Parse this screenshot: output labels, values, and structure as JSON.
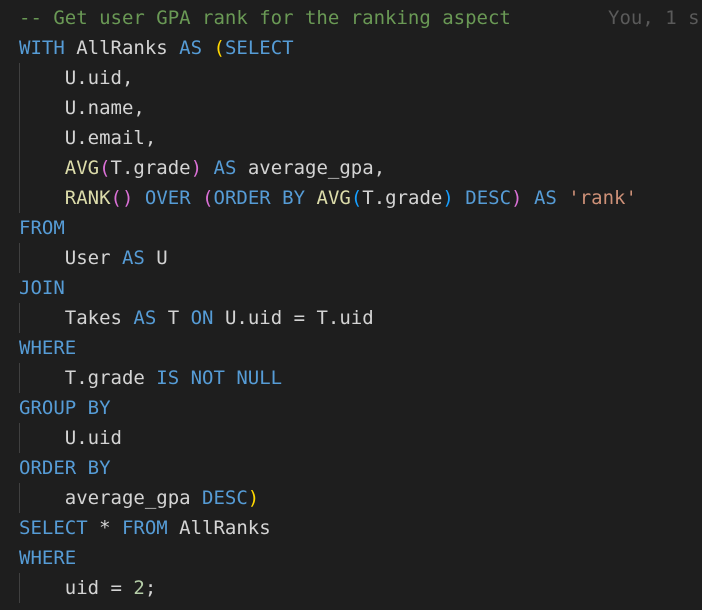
{
  "editor": {
    "language": "sql",
    "blame_text": "You, 1 s",
    "lines": [
      {
        "tokens": [
          {
            "t": "-- Get user GPA rank for the ranking aspect",
            "c": "comment"
          }
        ]
      },
      {
        "tokens": [
          {
            "t": "WITH",
            "c": "keyword"
          },
          {
            "t": " AllRanks ",
            "c": "ident"
          },
          {
            "t": "AS",
            "c": "keyword"
          },
          {
            "t": " ",
            "c": "ident"
          },
          {
            "t": "(",
            "c": "brace"
          },
          {
            "t": "SELECT",
            "c": "keyword"
          }
        ]
      },
      {
        "tokens": [
          {
            "t": "    U.uid,",
            "c": "ident"
          }
        ]
      },
      {
        "tokens": [
          {
            "t": "    U.name,",
            "c": "ident"
          }
        ]
      },
      {
        "tokens": [
          {
            "t": "    U.email,",
            "c": "ident"
          }
        ]
      },
      {
        "tokens": [
          {
            "t": "    ",
            "c": "ident"
          },
          {
            "t": "AVG",
            "c": "function"
          },
          {
            "t": "(",
            "c": "brace2"
          },
          {
            "t": "T.grade",
            "c": "ident"
          },
          {
            "t": ")",
            "c": "brace2"
          },
          {
            "t": " ",
            "c": "ident"
          },
          {
            "t": "AS",
            "c": "keyword"
          },
          {
            "t": " average_gpa,",
            "c": "ident"
          }
        ]
      },
      {
        "tokens": [
          {
            "t": "    ",
            "c": "ident"
          },
          {
            "t": "RANK",
            "c": "function"
          },
          {
            "t": "()",
            "c": "brace2"
          },
          {
            "t": " ",
            "c": "ident"
          },
          {
            "t": "OVER",
            "c": "keyword"
          },
          {
            "t": " ",
            "c": "ident"
          },
          {
            "t": "(",
            "c": "brace2"
          },
          {
            "t": "ORDER BY",
            "c": "keyword"
          },
          {
            "t": " ",
            "c": "ident"
          },
          {
            "t": "AVG",
            "c": "function"
          },
          {
            "t": "(",
            "c": "brace3"
          },
          {
            "t": "T.grade",
            "c": "ident"
          },
          {
            "t": ")",
            "c": "brace3"
          },
          {
            "t": " ",
            "c": "ident"
          },
          {
            "t": "DESC",
            "c": "keyword"
          },
          {
            "t": ")",
            "c": "brace2"
          },
          {
            "t": " ",
            "c": "ident"
          },
          {
            "t": "AS",
            "c": "keyword"
          },
          {
            "t": " ",
            "c": "ident"
          },
          {
            "t": "'rank'",
            "c": "string"
          }
        ]
      },
      {
        "tokens": [
          {
            "t": "FROM",
            "c": "keyword"
          }
        ]
      },
      {
        "tokens": [
          {
            "t": "    User ",
            "c": "ident"
          },
          {
            "t": "AS",
            "c": "keyword"
          },
          {
            "t": " U",
            "c": "ident"
          }
        ]
      },
      {
        "tokens": [
          {
            "t": "JOIN",
            "c": "keyword"
          }
        ]
      },
      {
        "tokens": [
          {
            "t": "    Takes ",
            "c": "ident"
          },
          {
            "t": "AS",
            "c": "keyword"
          },
          {
            "t": " T ",
            "c": "ident"
          },
          {
            "t": "ON",
            "c": "keyword"
          },
          {
            "t": " U.uid = T.uid",
            "c": "ident"
          }
        ]
      },
      {
        "tokens": [
          {
            "t": "WHERE",
            "c": "keyword"
          }
        ]
      },
      {
        "tokens": [
          {
            "t": "    T.grade ",
            "c": "ident"
          },
          {
            "t": "IS NOT NULL",
            "c": "keyword"
          }
        ]
      },
      {
        "tokens": [
          {
            "t": "GROUP BY",
            "c": "keyword"
          }
        ]
      },
      {
        "tokens": [
          {
            "t": "    U.uid",
            "c": "ident"
          }
        ]
      },
      {
        "tokens": [
          {
            "t": "ORDER BY",
            "c": "keyword"
          }
        ]
      },
      {
        "tokens": [
          {
            "t": "    average_gpa ",
            "c": "ident"
          },
          {
            "t": "DESC",
            "c": "keyword"
          },
          {
            "t": ")",
            "c": "brace"
          }
        ]
      },
      {
        "tokens": [
          {
            "t": "SELECT",
            "c": "keyword"
          },
          {
            "t": " * ",
            "c": "ident"
          },
          {
            "t": "FROM",
            "c": "keyword"
          },
          {
            "t": " AllRanks",
            "c": "ident"
          }
        ]
      },
      {
        "tokens": [
          {
            "t": "WHERE",
            "c": "keyword"
          }
        ]
      },
      {
        "tokens": [
          {
            "t": "    uid = ",
            "c": "ident"
          },
          {
            "t": "2",
            "c": "number"
          },
          {
            "t": ";",
            "c": "ident"
          }
        ]
      }
    ]
  },
  "colors": {
    "background": "#1e1e1e",
    "comment": "#6a9955",
    "keyword": "#569cd6",
    "function": "#dcdcaa",
    "string": "#ce9178",
    "number": "#b5cea8",
    "identifier": "#d4d4d4"
  }
}
